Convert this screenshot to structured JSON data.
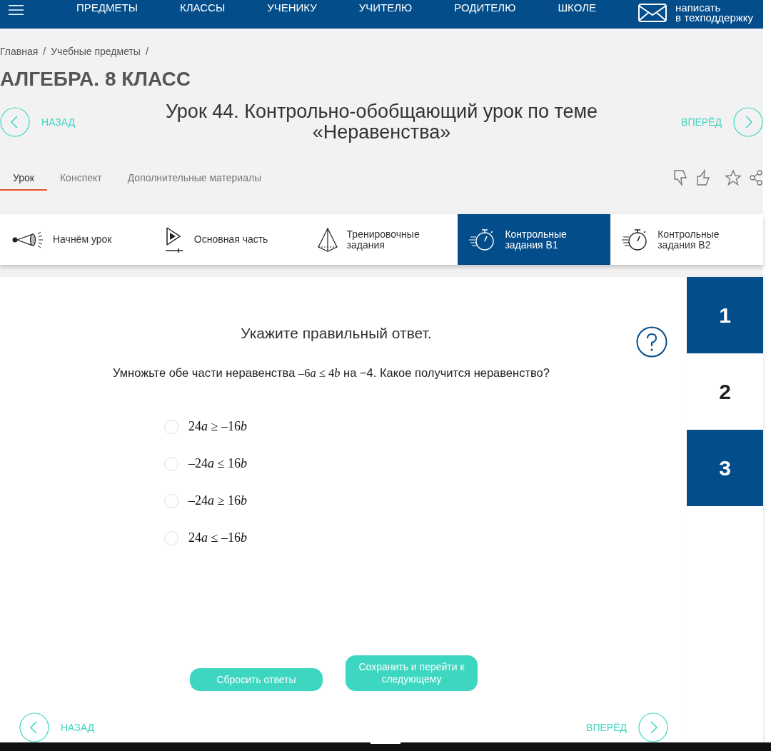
{
  "header": {
    "nav": [
      "ПРЕДМЕТЫ",
      "КЛАССЫ",
      "УЧЕНИКУ",
      "УЧИТЕЛЮ",
      "РОДИТЕЛЮ",
      "ШКОЛЕ"
    ],
    "support": [
      "написать",
      "в техподдержку"
    ]
  },
  "breadcrumbs": [
    {
      "label": "Главная",
      "separator": "/"
    },
    {
      "label": "Учебные предметы",
      "separator": "/"
    }
  ],
  "course_title": "АЛГЕБРА. 8 КЛАСС",
  "lesson": {
    "back": "НАЗАД",
    "title": "Урок 44. Контрольно-обобщающий урок по теме «Неравенства»",
    "forward": "ВПЕРЁД"
  },
  "tabs": [
    {
      "label": "Урок",
      "selected": true
    },
    {
      "label": "Конспект",
      "selected": false
    },
    {
      "label": "Дополнительные материалы",
      "selected": false
    }
  ],
  "steps": [
    {
      "kind": "start",
      "label": "Начнём урок",
      "selected": false
    },
    {
      "kind": "main",
      "label": "Основная часть",
      "selected": false
    },
    {
      "kind": "training",
      "label": "Тренировочные задания",
      "selected": false
    },
    {
      "kind": "test",
      "label": "Контрольные задания B1",
      "selected": true
    },
    {
      "kind": "test",
      "label": "Контрольные задания B2",
      "selected": false
    }
  ],
  "task": {
    "heading": "Укажите правильный ответ.",
    "question": [
      {
        "text": "Умножьте обе части неравенства ",
        "kind": "plain"
      },
      {
        "text": "–6",
        "kind": "math"
      },
      {
        "text": "a",
        "kind": "var"
      },
      {
        "text": " ≤ 4",
        "kind": "math"
      },
      {
        "text": "b",
        "kind": "var"
      },
      {
        "text": " на −4. Какое получится неравенство?",
        "kind": "plain"
      }
    ],
    "options": [
      {
        "parts": [
          {
            "text": "24",
            "kind": "math"
          },
          {
            "text": "a",
            "kind": "var"
          },
          {
            "text": " ≥ –16",
            "kind": "math"
          },
          {
            "text": "b",
            "kind": "var"
          }
        ],
        "selected": false
      },
      {
        "parts": [
          {
            "text": "–24",
            "kind": "math"
          },
          {
            "text": "a",
            "kind": "var"
          },
          {
            "text": " ≤ 16",
            "kind": "math"
          },
          {
            "text": "b",
            "kind": "var"
          }
        ],
        "selected": false
      },
      {
        "parts": [
          {
            "text": "–24",
            "kind": "math"
          },
          {
            "text": "a",
            "kind": "var"
          },
          {
            "text": " ≥ 16",
            "kind": "math"
          },
          {
            "text": "b",
            "kind": "var"
          }
        ],
        "selected": false
      },
      {
        "parts": [
          {
            "text": "24",
            "kind": "math"
          },
          {
            "text": "a",
            "kind": "var"
          },
          {
            "text": " ≤ –16",
            "kind": "math"
          },
          {
            "text": "b",
            "kind": "var"
          }
        ],
        "selected": false
      }
    ],
    "buttons": [
      "Сбросить ответы",
      "Сохранить и перейти к следующему"
    ]
  },
  "questions": [
    {
      "label": "1",
      "selected": false
    },
    {
      "label": "2",
      "selected": true
    },
    {
      "label": "3",
      "selected": false
    }
  ],
  "footer_nav": {
    "back": "НАЗАД",
    "forward": "ВПЕРЁД"
  }
}
